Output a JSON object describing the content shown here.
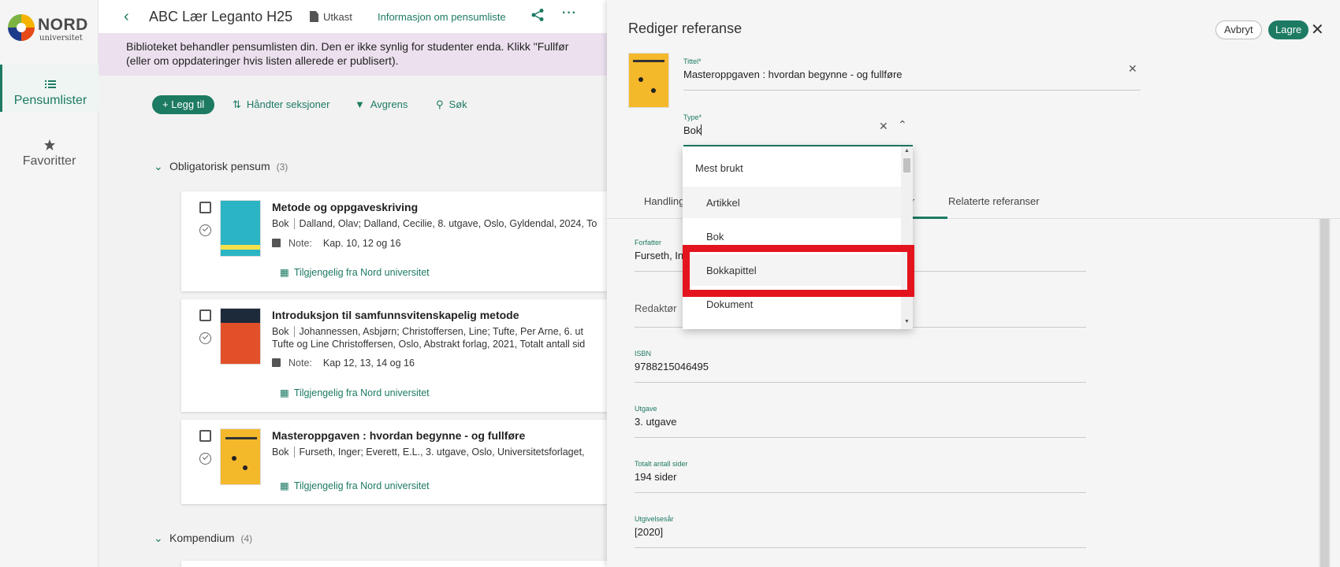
{
  "sidebar": {
    "logo_text": "NORD",
    "logo_sub": "universitet",
    "items": [
      {
        "label": "Pensumlister",
        "icon": "list-icon"
      },
      {
        "label": "Favoritter",
        "icon": "star-icon"
      }
    ]
  },
  "header": {
    "title": "ABC Lær Leganto H25",
    "status": "Utkast",
    "info_link": "Informasjon om pensumliste",
    "more": "···"
  },
  "banner": {
    "line1": "Biblioteket behandler pensumlisten din. Den er ikke synlig for studenter enda. Klikk \"Fullfør",
    "line2": "(eller om oppdateringer hvis listen allerede er publisert)."
  },
  "toolbar": {
    "add": "+ Legg til",
    "manage_sections": "Håndter seksjoner",
    "filter": "Avgrens",
    "search": "Søk"
  },
  "sections": [
    {
      "title": "Obligatorisk pensum",
      "count": "(3)"
    },
    {
      "title": "Kompendium",
      "count": "(4)"
    }
  ],
  "items": [
    {
      "title": "Metode og oppgaveskriving",
      "type": "Bok",
      "meta": "Dalland, Olav; Dalland, Cecilie, 8. utgave, Oslo, Gyldendal, 2024, To",
      "meta2": "",
      "note_label": "Note:",
      "note": "Kap. 10, 12 og 16",
      "availability": "Tilgjengelig fra Nord universitet",
      "cover_color": "#2bb5c4"
    },
    {
      "title": "Introduksjon til samfunnsvitenskapelig metode",
      "type": "Bok",
      "meta": "Johannessen, Asbjørn; Christoffersen, Line; Tufte, Per Arne, 6. ut",
      "meta2": "Tufte og Line Christoffersen, Oslo, Abstrakt forlag, 2021, Totalt antall sid",
      "note_label": "Note:",
      "note": "Kap 12, 13, 14 og 16",
      "availability": "Tilgjengelig fra Nord universitet",
      "cover_color": "#e2502a"
    },
    {
      "title": "Masteroppgaven : hvordan begynne - og fullføre",
      "type": "Bok",
      "meta": "Furseth, Inger; Everett, E.L., 3. utgave, Oslo, Universitetsforlaget,",
      "meta2": "",
      "note_label": "",
      "note": "",
      "availability": "Tilgjengelig fra Nord universitet",
      "cover_color": "#f4b82b"
    }
  ],
  "panel": {
    "title": "Rediger referanse",
    "cancel": "Avbryt",
    "save": "Lagre",
    "fields": {
      "title_label": "Tittel*",
      "title_value": "Masteroppgaven : hvordan begynne - og fullføre",
      "type_label": "Type*",
      "type_value": "Bok",
      "author_label": "Forfatter",
      "author_value": "Furseth, In",
      "editor_label": "Redaktør",
      "isbn_label": "ISBN",
      "isbn_value": "9788215046495",
      "edition_label": "Utgave",
      "edition_value": "3. utgave",
      "pages_label": "Totalt antall sider",
      "pages_value": "194 sider",
      "year_label": "Utgivelsesår",
      "year_value": "[2020]"
    },
    "tabs": {
      "first": "Handling",
      "mid": "r",
      "related": "Relaterte referanser"
    }
  },
  "type_dropdown": {
    "group": "Mest brukt",
    "options": [
      "Artikkel",
      "Bok",
      "Bokkapittel",
      "Dokument"
    ],
    "highlighted": "Bokkapittel"
  },
  "colors": {
    "accent": "#1d7a63",
    "banner": "#ece0ee",
    "highlight": "#e4141e"
  }
}
